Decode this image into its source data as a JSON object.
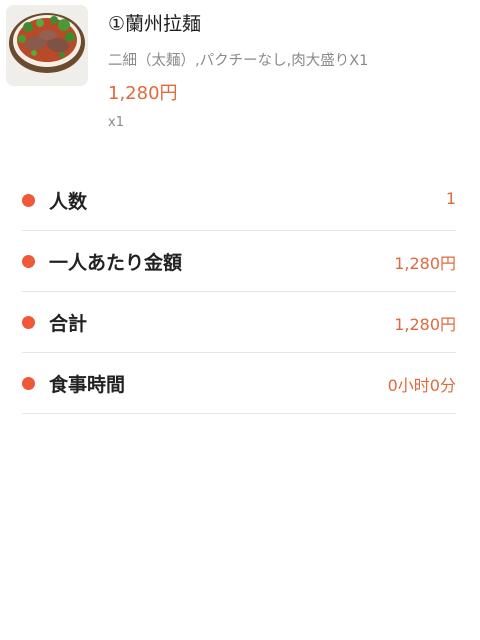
{
  "item": {
    "image_icon": "ramen-bowl-photo",
    "name": "①蘭州拉麺",
    "options": "二細（太麺）,パクチーなし,肉大盛りX1",
    "price": "1,280円",
    "quantity": "x1"
  },
  "summary": [
    {
      "label": "人数",
      "value": "1"
    },
    {
      "label": "一人あたり金額",
      "value": "1,280円"
    },
    {
      "label": "合計",
      "value": "1,280円"
    },
    {
      "label": "食事時間",
      "value": "0小时0分"
    }
  ],
  "colors": {
    "accent": "#e06a3c",
    "bullet": "#f0583a",
    "divider": "#e6e6e6"
  }
}
